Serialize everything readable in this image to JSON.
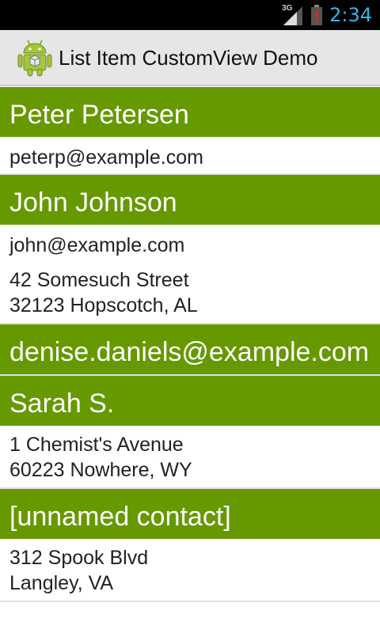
{
  "status_bar": {
    "time": "2:34",
    "network": "3G",
    "clock_color": "#33b5e5",
    "icons": [
      "signal-3g-icon",
      "battery-alert-icon"
    ]
  },
  "action_bar": {
    "title": "List Item CustomView Demo",
    "icon": "android-app-icon"
  },
  "colors": {
    "header_bg": "#669900",
    "header_text": "#ffffff",
    "action_bar_bg": "#e6e6e6"
  },
  "contacts": [
    {
      "name": "Peter Petersen",
      "email": "peterp@example.com"
    },
    {
      "name": "John Johnson",
      "email": "john@example.com",
      "address_line1": "42 Somesuch Street",
      "address_line2": "32123 Hopscotch, AL"
    },
    {
      "name": "denise.daniels@example.com"
    },
    {
      "name": "Sarah S.",
      "address_line1": "1 Chemist's Avenue",
      "address_line2": "60223 Nowhere, WY"
    },
    {
      "name": "[unnamed contact]",
      "address_line1": "312 Spook Blvd",
      "address_line2": "Langley, VA"
    }
  ]
}
